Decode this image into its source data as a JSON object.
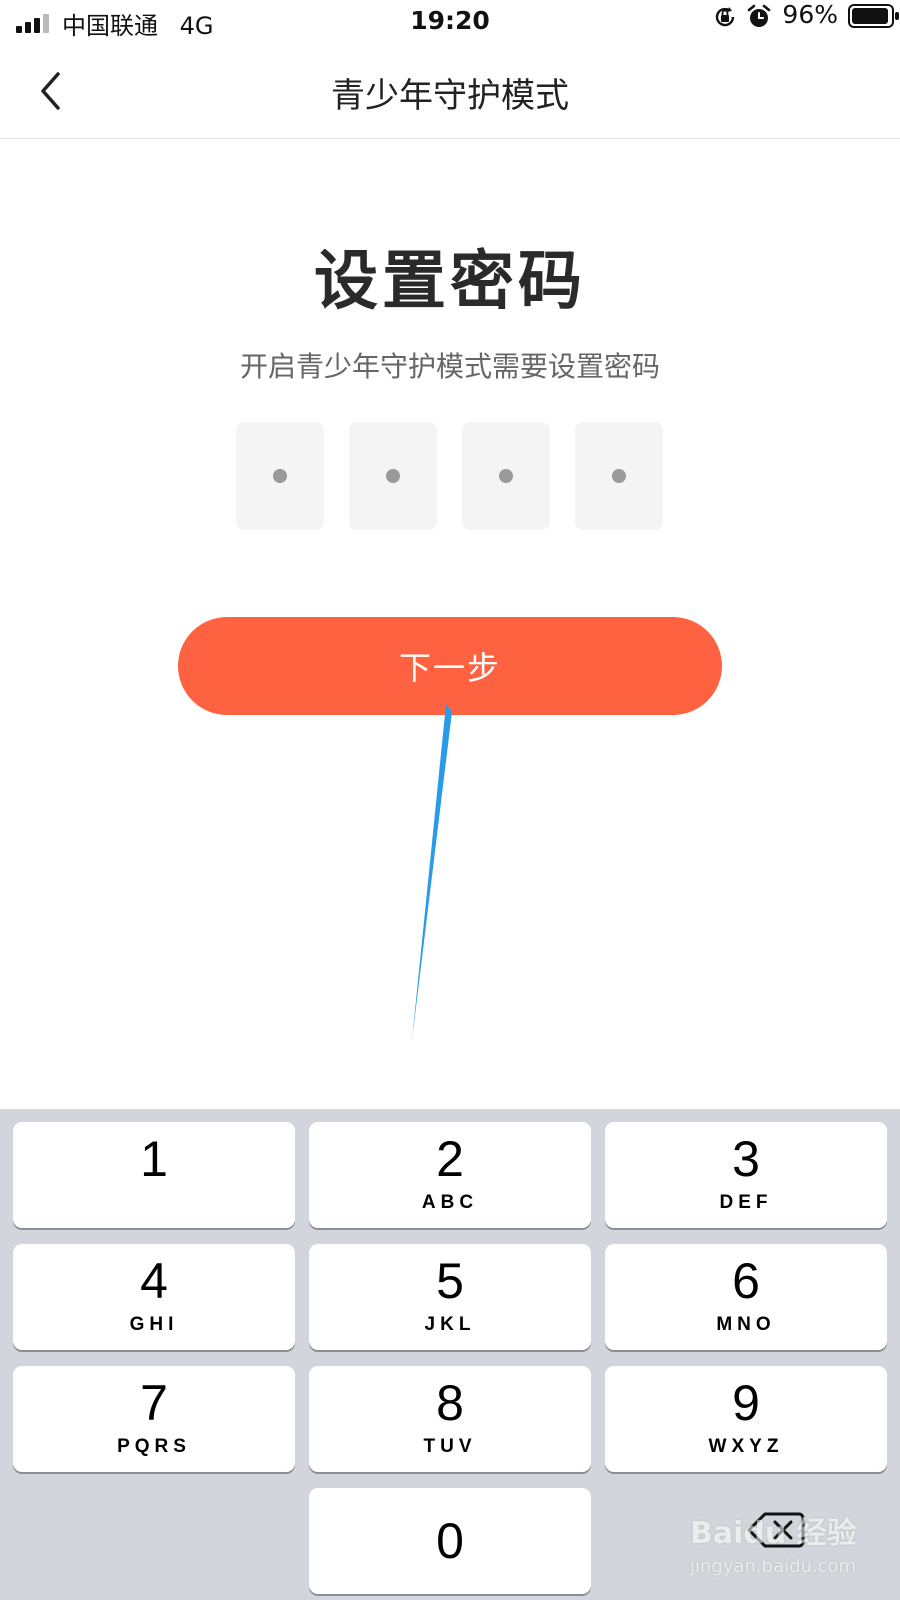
{
  "status_bar": {
    "carrier": "中国联通",
    "network": "4G",
    "time": "19:20",
    "battery_percent": "96%",
    "battery_level": 0.96,
    "icons": [
      "signal-icon",
      "rotation-lock-icon",
      "alarm-icon",
      "battery-icon"
    ]
  },
  "nav": {
    "title": "青少年守护模式",
    "back_icon": "chevron-left-icon"
  },
  "main": {
    "title": "设置密码",
    "subtitle": "开启青少年守护模式需要设置密码",
    "pin_length": 4,
    "next_button": "下一步"
  },
  "keypad": {
    "keys": [
      {
        "digit": "1",
        "letters": ""
      },
      {
        "digit": "2",
        "letters": "ABC"
      },
      {
        "digit": "3",
        "letters": "DEF"
      },
      {
        "digit": "4",
        "letters": "GHI"
      },
      {
        "digit": "5",
        "letters": "JKL"
      },
      {
        "digit": "6",
        "letters": "MNO"
      },
      {
        "digit": "7",
        "letters": "PQRS"
      },
      {
        "digit": "8",
        "letters": "TUV"
      },
      {
        "digit": "9",
        "letters": "WXYZ"
      },
      {
        "digit": "0",
        "letters": ""
      }
    ],
    "delete_icon": "backspace-icon"
  },
  "watermark": {
    "brand": "Baidu 经验",
    "url": "jingyan.baidu.com"
  },
  "colors": {
    "accent": "#ff6240",
    "keypad_background": "#d2d5db",
    "pin_box": "#f4f4f4",
    "annotation": "#2a9be8"
  }
}
